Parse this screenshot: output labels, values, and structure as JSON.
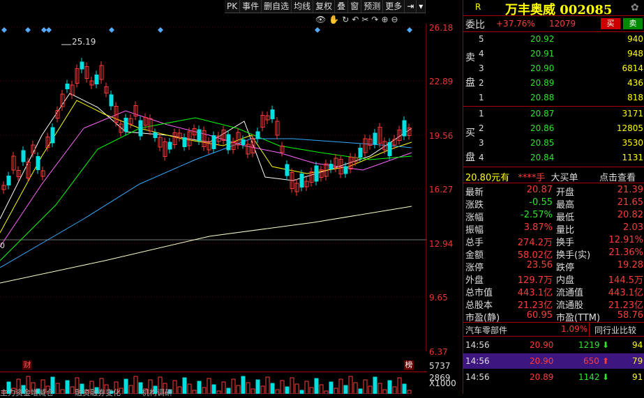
{
  "toolbar": {
    "items": [
      "PK",
      "事件",
      "删自选",
      "均线",
      "复权",
      "叠",
      "窗",
      "预测",
      "更多"
    ],
    "icon_label": "⇥"
  },
  "chart": {
    "max_label": "25.19",
    "price_labels": [
      "26.18",
      "22.89",
      "19.56",
      "16.27",
      "12.94",
      "9.65",
      "6.37"
    ],
    "zero_label": "0",
    "marker_left": "财",
    "marker_right": "榜",
    "volume_labels": [
      "5737",
      "2869",
      "X1000"
    ],
    "bottom_tabs": [
      "主力资金增减仓",
      "融资融券变化",
      "机构调研"
    ],
    "colors": {
      "up": "#ff3b3b",
      "down": "#00e0e0",
      "ma5": "#ffffff",
      "ma10": "#ffff00",
      "ma20": "#ff66ff",
      "ma30": "#00ff00",
      "ma60": "#33aaff",
      "ma250": "#ffffcc"
    }
  },
  "quote": {
    "market_tag": "R",
    "name": "万丰奥威 002085",
    "webi_label": "委比",
    "webi_pct": "+37.76%",
    "webi_diff": "12079",
    "buy_btn": "买",
    "sell_btn": "卖",
    "sell_label": "卖\n盘",
    "buy_label": "买\n盘",
    "asks": [
      {
        "level": "5",
        "price": "20.92",
        "vol": "940"
      },
      {
        "level": "4",
        "price": "20.91",
        "vol": "948"
      },
      {
        "level": "3",
        "price": "20.90",
        "vol": "6814"
      },
      {
        "level": "2",
        "price": "20.89",
        "vol": "436"
      },
      {
        "level": "1",
        "price": "20.88",
        "vol": "818"
      }
    ],
    "bids": [
      {
        "level": "1",
        "price": "20.87",
        "vol": "3171"
      },
      {
        "level": "2",
        "price": "20.86",
        "vol": "12805"
      },
      {
        "level": "3",
        "price": "20.85",
        "vol": "3530"
      },
      {
        "level": "4",
        "price": "20.84",
        "vol": "1131"
      }
    ],
    "big_order": {
      "left": "20.80元有",
      "stars": "****手",
      "mid": "大买单",
      "link": "点击查看"
    },
    "stats": [
      [
        "最新",
        "20.87",
        "开盘",
        "21.39"
      ],
      [
        "涨跌",
        "-0.55",
        "最高",
        "21.65"
      ],
      [
        "涨幅",
        "-2.57%",
        "最低",
        "20.82"
      ],
      [
        "振幅",
        "3.87%",
        "量比",
        "2.03"
      ],
      [
        "总手",
        "274.2万",
        "换手",
        "12.91%"
      ],
      [
        "金额",
        "58.02亿",
        "换手(实)",
        "21.36%"
      ],
      [
        "涨停",
        "23.56",
        "跌停",
        "19.28"
      ],
      [
        "外盘",
        "129.7万",
        "内盘",
        "144.5万"
      ],
      [
        "总市值",
        "443.1亿",
        "流通值",
        "443.1亿"
      ],
      [
        "总股本",
        "21.23亿",
        "流通股",
        "21.23亿"
      ],
      [
        "市盈(静)",
        "60.95",
        "市盈(TTM)",
        "58.76"
      ]
    ],
    "sector": {
      "name": "汽车零部件",
      "pct": "1.09%",
      "compare": "同行业比较"
    },
    "ticks": [
      {
        "time": "14:56",
        "price": "20.90",
        "vol": "1219",
        "dir": "down",
        "n": "94"
      },
      {
        "time": "14:56",
        "price": "20.90",
        "vol": "650",
        "dir": "up",
        "n": "79"
      },
      {
        "time": "14:56",
        "price": "20.89",
        "vol": "1142",
        "dir": "down",
        "n": "91"
      }
    ]
  }
}
